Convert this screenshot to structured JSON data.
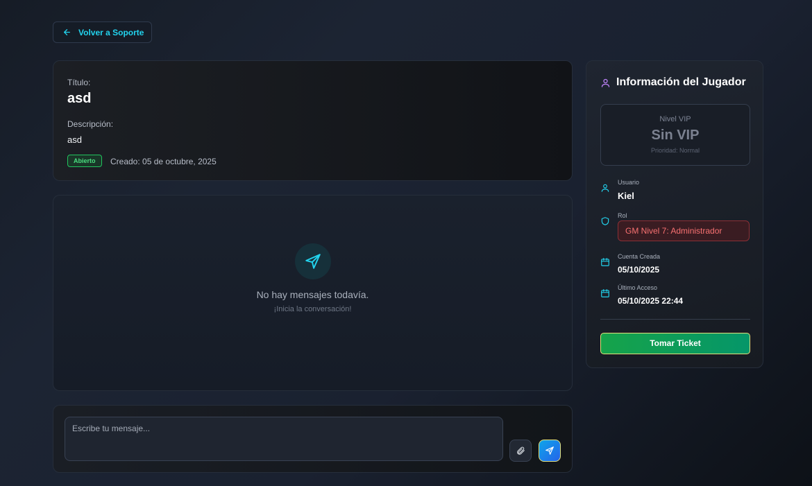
{
  "back_button": {
    "label": "Volver a Soporte"
  },
  "ticket": {
    "title_label": "Título:",
    "title": "asd",
    "description_label": "Descripción:",
    "description": "asd",
    "status": "Abierto",
    "created": "Creado: 05 de octubre, 2025"
  },
  "messages": {
    "empty_title": "No hay mensajes todavía.",
    "empty_subtitle": "¡Inicia la conversación!"
  },
  "compose": {
    "placeholder": "Escribe tu mensaje..."
  },
  "player": {
    "heading": "Información del Jugador",
    "vip": {
      "label": "Nivel VIP",
      "value": "Sin VIP",
      "priority": "Prioridad: Normal"
    },
    "user_label": "Usuario",
    "user_value": "Kiel",
    "role_label": "Rol",
    "role_value": "GM Nivel 7: Administrador",
    "created_label": "Cuenta Creada",
    "created_value": "05/10/2025",
    "last_access_label": "Último Acceso",
    "last_access_value": "05/10/2025 22:44",
    "take_button": "Tomar Ticket"
  },
  "colors": {
    "accent": "#22d3ee",
    "status_open": "#4ade80",
    "role": "#f87171",
    "take_button": "#16a34a"
  },
  "icons": {
    "back": "arrow-left-icon",
    "empty": "send-icon",
    "attach": "paperclip-icon",
    "send": "send-icon",
    "player": "user-icon",
    "role": "shield-icon",
    "calendar": "calendar-icon"
  }
}
